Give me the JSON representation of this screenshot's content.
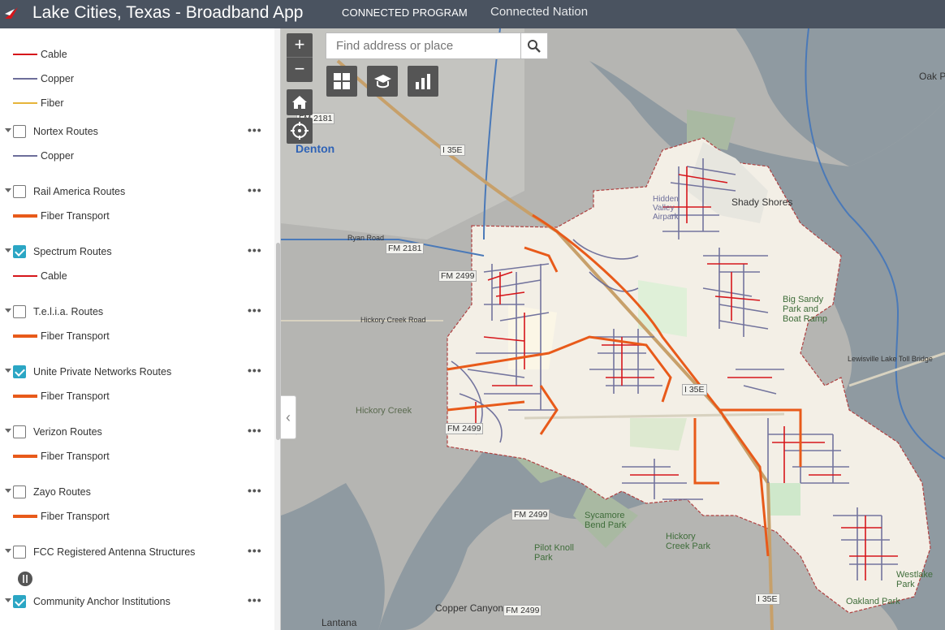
{
  "header": {
    "title": "Lake Cities, Texas - Broadband App",
    "nav": [
      "CONNECTED PROGRAM",
      "Connected Nation"
    ]
  },
  "sidebar": {
    "legend_top": [
      {
        "label": "Cable",
        "style": "cable"
      },
      {
        "label": "Copper",
        "style": "copper"
      },
      {
        "label": "Fiber",
        "style": "fiber"
      }
    ],
    "layers": [
      {
        "label": "Nortex Routes",
        "checked": false,
        "legend": [
          {
            "label": "Copper",
            "style": "copper"
          }
        ]
      },
      {
        "label": "Rail America Routes",
        "checked": false,
        "legend": [
          {
            "label": "Fiber Transport",
            "style": "transport"
          }
        ]
      },
      {
        "label": "Spectrum Routes",
        "checked": true,
        "legend": [
          {
            "label": "Cable",
            "style": "cable"
          }
        ]
      },
      {
        "label": "T.e.l.i.a. Routes",
        "checked": false,
        "legend": [
          {
            "label": "Fiber Transport",
            "style": "transport"
          }
        ]
      },
      {
        "label": "Unite Private Networks Routes",
        "checked": true,
        "legend": [
          {
            "label": "Fiber Transport",
            "style": "transport"
          }
        ]
      },
      {
        "label": "Verizon Routes",
        "checked": false,
        "legend": [
          {
            "label": "Fiber Transport",
            "style": "transport"
          }
        ]
      },
      {
        "label": "Zayo Routes",
        "checked": false,
        "legend": [
          {
            "label": "Fiber Transport",
            "style": "transport"
          }
        ]
      },
      {
        "label": "FCC Registered Antenna Structures",
        "checked": false,
        "legend": []
      },
      {
        "label": "Community Anchor Institutions",
        "checked": true,
        "legend": []
      }
    ],
    "more_label": "•••"
  },
  "map": {
    "search_placeholder": "Find address or place",
    "zoom_in": "+",
    "zoom_out": "−",
    "labels": [
      {
        "text": "Denton"
      },
      {
        "text": "Shady Shores"
      },
      {
        "text": "Hickory Creek"
      },
      {
        "text": "Copper Canyon"
      },
      {
        "text": "Lantana"
      },
      {
        "text": "Oak P"
      },
      {
        "text": "Big Sandy Park and Boat Ramp"
      },
      {
        "text": "Sycamore Bend Park"
      },
      {
        "text": "Hickory Creek Park"
      },
      {
        "text": "Pilot Knoll Park"
      },
      {
        "text": "Westlake Park"
      },
      {
        "text": "Oakland Park"
      },
      {
        "text": "Hidden Valley Airpark"
      },
      {
        "text": "Ryan Road"
      },
      {
        "text": "Hickory Creek Road"
      },
      {
        "text": "Lewisville Lake Toll Bridge"
      }
    ],
    "shields": [
      "FM 2181",
      "I 35E",
      "FM 2181",
      "FM 2499",
      "FM 2499",
      "FM 2499",
      "FM 2499",
      "I 35E",
      "I 35E"
    ]
  },
  "colors": {
    "header_bg": "#4a5360",
    "cable": "#d6161b",
    "copper": "#6d6e9a",
    "fiber": "#e6b53a",
    "transport": "#e85a1a",
    "check": "#2ba6c4"
  },
  "icons": [
    "app-logo-icon",
    "more-icon",
    "search-icon",
    "home-icon",
    "locate-icon",
    "basemap-gallery-icon",
    "education-icon",
    "chart-icon",
    "chevron-left-icon",
    "antenna-icon"
  ]
}
